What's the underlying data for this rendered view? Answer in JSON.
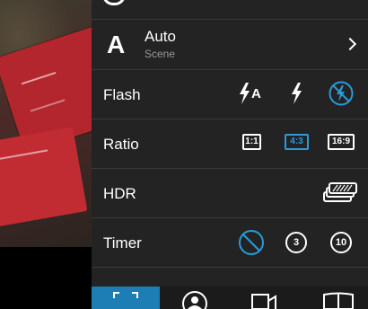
{
  "scene": {
    "letter": "A",
    "title": "Auto",
    "subtitle": "Scene"
  },
  "flash": {
    "label": "Flash",
    "options": [
      "flash-auto",
      "flash-on",
      "flash-off"
    ],
    "selected": "flash-off"
  },
  "ratio": {
    "label": "Ratio",
    "options": [
      "1:1",
      "4:3",
      "16:9"
    ],
    "selected": "4:3"
  },
  "hdr": {
    "label": "HDR"
  },
  "timer": {
    "label": "Timer",
    "options": [
      "off",
      "3",
      "10"
    ],
    "selected": "off"
  },
  "colors": {
    "accent": "#2a9ad8",
    "panel": "#232323"
  }
}
